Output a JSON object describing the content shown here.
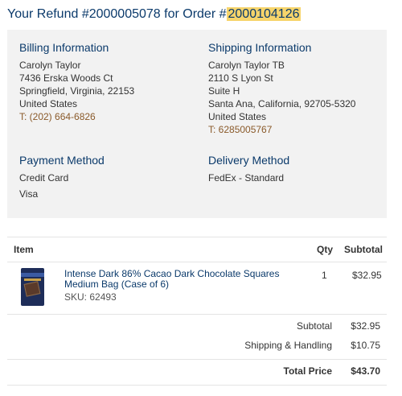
{
  "header": {
    "title_prefix": "Your Refund #2000005078 for Order #",
    "order_number": "2000104126"
  },
  "billing": {
    "title": "Billing Information",
    "name": "Carolyn Taylor",
    "street": "7436 Erska Woods Ct",
    "city_line": "Springfield, Virginia, 22153",
    "country": "United States",
    "phone": "T: (202) 664-6826"
  },
  "shipping": {
    "title": "Shipping Information",
    "name": "Carolyn Taylor TB",
    "street": "2110 S Lyon St",
    "street2": "Suite H",
    "city_line": "Santa Ana, California, 92705-5320",
    "country": "United States",
    "phone": "T: 6285005767"
  },
  "payment": {
    "title": "Payment Method",
    "method": "Credit Card",
    "card": "Visa"
  },
  "delivery": {
    "title": "Delivery Method",
    "method": "FedEx - Standard"
  },
  "table": {
    "headers": {
      "item": "Item",
      "qty": "Qty",
      "subtotal": "Subtotal"
    },
    "rows": [
      {
        "name": "Intense Dark 86% Cacao Dark Chocolate Squares Medium Bag (Case of 6)",
        "sku": "SKU: 62493",
        "qty": "1",
        "subtotal": "$32.95"
      }
    ]
  },
  "totals": {
    "subtotal_label": "Subtotal",
    "subtotal_value": "$32.95",
    "shipping_label": "Shipping & Handling",
    "shipping_value": "$10.75",
    "total_label": "Total Price",
    "total_value": "$43.70"
  },
  "colors": {
    "heading": "#0b3a6b",
    "highlight": "#f6d46b",
    "panel": "#f2f2f2",
    "link": "#8a5a2a"
  }
}
